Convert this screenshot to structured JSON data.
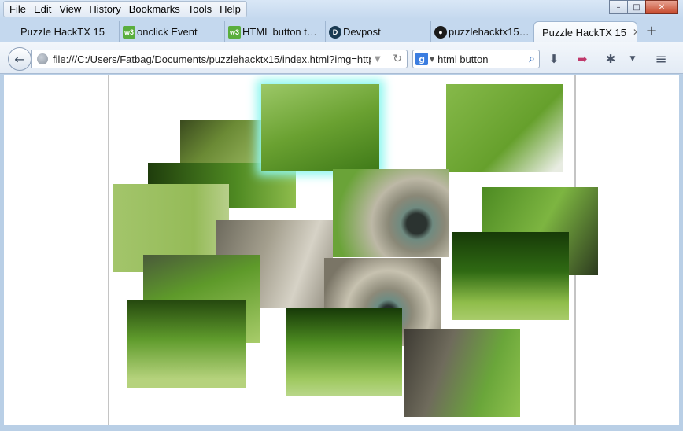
{
  "menu": [
    "File",
    "Edit",
    "View",
    "History",
    "Bookmarks",
    "Tools",
    "Help"
  ],
  "window_controls": {
    "minimize": "–",
    "maximize": "□",
    "close": "✕"
  },
  "tabs": [
    {
      "label": "Puzzle HackTX 15",
      "favicon": "blank-page-icon"
    },
    {
      "label": "onclick Event",
      "favicon": "w3schools-icon"
    },
    {
      "label": "HTML button t…",
      "favicon": "w3schools-icon"
    },
    {
      "label": "Devpost",
      "favicon": "devpost-icon"
    },
    {
      "label": "puzzlehacktx15…",
      "favicon": "github-icon"
    },
    {
      "label": "Puzzle HackTX 15",
      "favicon": "none",
      "active": true
    }
  ],
  "tab_close": "✕",
  "new_tab": "+",
  "navbar": {
    "url": "file:///C:/Users/Fatbag/Documents/puzzlehacktx15/index.html?img=http%",
    "search_engine_letter": "g",
    "search_value": "html button"
  },
  "puzzle": {
    "piece_count": 14,
    "selected_piece": 1
  }
}
